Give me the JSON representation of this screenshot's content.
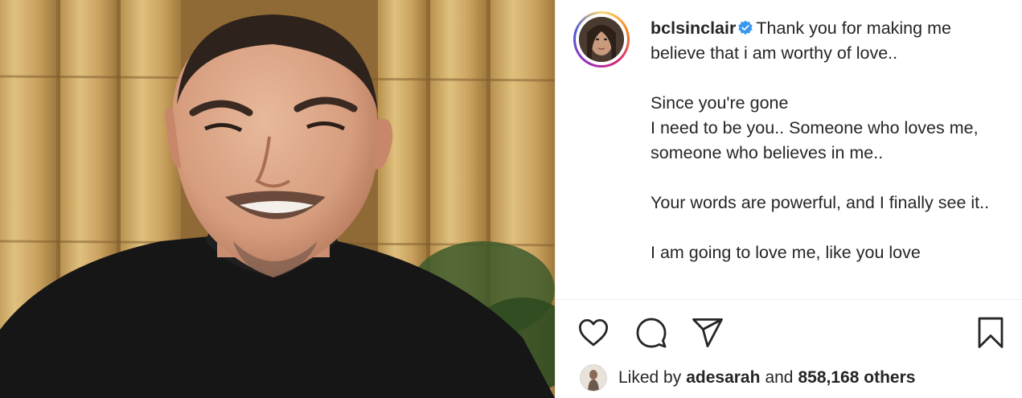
{
  "photo": {
    "icon": "portrait-photo"
  },
  "post": {
    "username": "bclsinclair",
    "verified_icon": "verified-badge-icon",
    "caption": {
      "line1": "Thank you for making me believe that i am worthy of love..",
      "para2a": "Since you're gone",
      "para2b": "I need to be you.. Someone who loves me, someone who believes in me..",
      "para3": "Your words are powerful, and I finally see it..",
      "para4": "I am going to love me, like you love"
    }
  },
  "actions": {
    "like_icon": "heart-icon",
    "comment_icon": "comment-icon",
    "share_icon": "send-icon",
    "save_icon": "bookmark-icon"
  },
  "likes": {
    "prefix": "Liked by",
    "user": "adesarah",
    "middle": "and",
    "count": "858,168 others"
  },
  "colors": {
    "verified": "#3897f0",
    "text": "#262626",
    "divider": "#efefef"
  }
}
